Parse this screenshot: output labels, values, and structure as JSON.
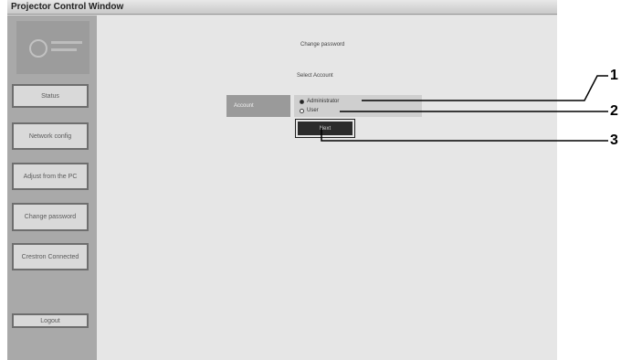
{
  "window": {
    "title": "Projector Control Window"
  },
  "sidebar": {
    "buttons": [
      {
        "label": "Status"
      },
      {
        "label": "Network config"
      },
      {
        "label": "Adjust from the PC"
      },
      {
        "label": "Change password"
      },
      {
        "label": "Crestron Connected"
      },
      {
        "label": "Logout"
      }
    ]
  },
  "main": {
    "heading": "Change password",
    "select_caption": "Select Account",
    "account_label": "Account",
    "options": [
      {
        "label": "Administrator",
        "selected": true
      },
      {
        "label": "User",
        "selected": false
      }
    ],
    "next_label": "Next"
  },
  "callouts": [
    "1",
    "2",
    "3"
  ]
}
